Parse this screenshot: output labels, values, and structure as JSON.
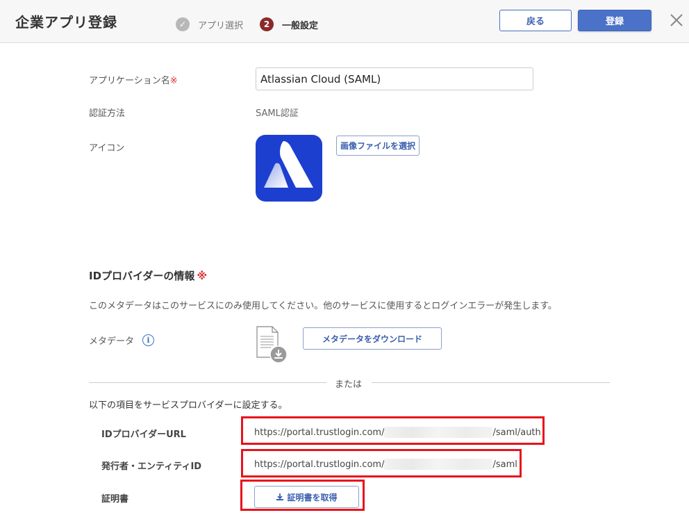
{
  "header": {
    "title": "企業アプリ登録",
    "steps": [
      {
        "label": "アプリ選択",
        "marker": "✓",
        "state": "done"
      },
      {
        "label": "一般設定",
        "marker": "2",
        "state": "current"
      }
    ],
    "back_label": "戻る",
    "register_label": "登録",
    "close_icon": "close-icon"
  },
  "form": {
    "app_name_label": "アプリケーション名",
    "required_mark": "※",
    "app_name_value": "Atlassian Cloud (SAML)",
    "auth_label": "認証方法",
    "auth_value": "SAML認証",
    "icon_label": "アイコン",
    "icon_name": "atlassian-logo-icon",
    "icon_bg": "#1d3fd0",
    "file_button_label": "画像ファイルを選択"
  },
  "idp": {
    "title": "IDプロバイダーの情報",
    "required_mark": "※",
    "description": "このメタデータはこのサービスにのみ使用してください。他のサービスに使用するとログインエラーが発生します。",
    "metadata_label": "メタデータ",
    "info_icon_glyph": "i",
    "download_button_label": "メタデータをダウンロード",
    "divider_text": "または",
    "sp_description": "以下の項目をサービスプロバイダーに設定する。",
    "idp_url_label": "IDプロバイダーURL",
    "idp_url_prefix": "https://portal.trustlogin.com/",
    "idp_url_suffix": "/saml/auth",
    "issuer_label": "発行者・エンティティID",
    "issuer_prefix": "https://portal.trustlogin.com/",
    "issuer_suffix": "/saml",
    "cert_label": "証明書",
    "cert_button_label": "証明書を取得"
  },
  "colors": {
    "accent": "#4a72c8",
    "highlight": "#e8121b",
    "required": "#d33333"
  }
}
